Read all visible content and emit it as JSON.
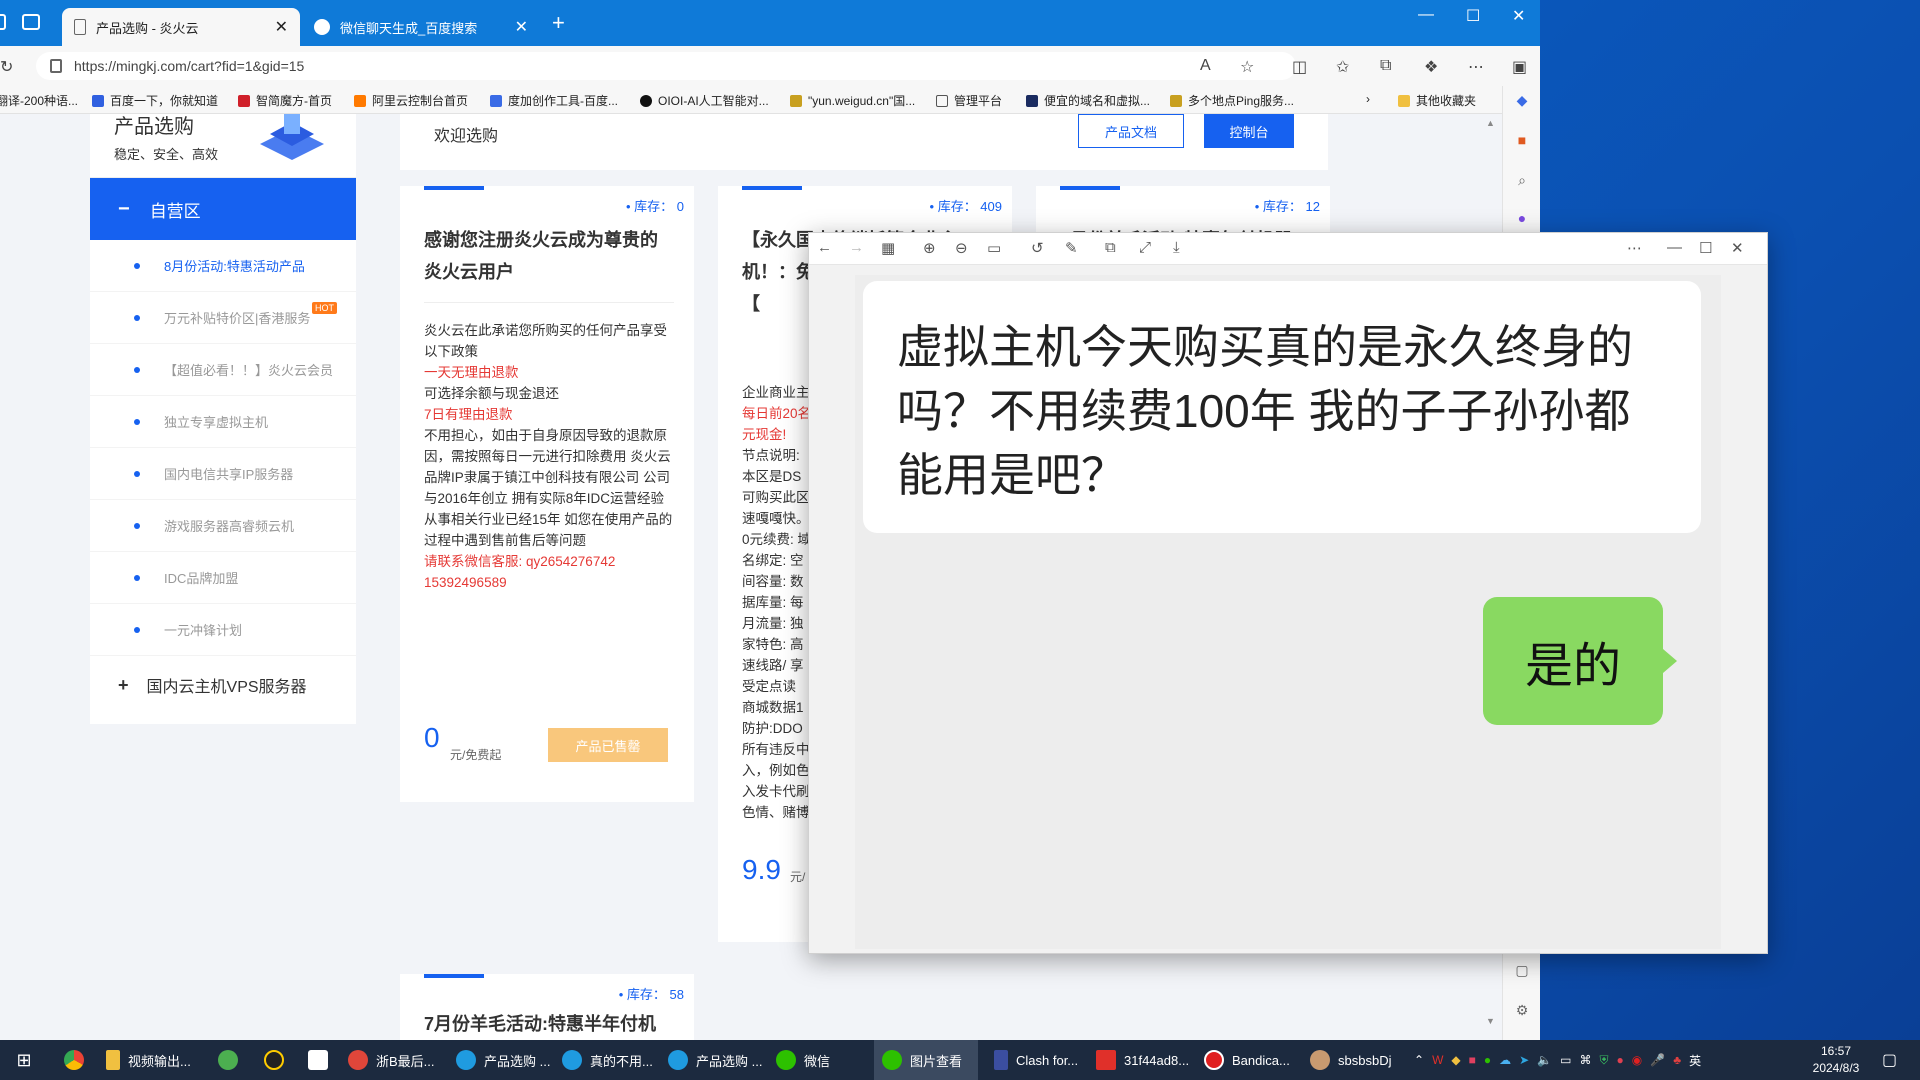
{
  "browser": {
    "tabs": [
      {
        "title": "产品选购 - 炎火云",
        "active": true
      },
      {
        "title": "微信聊天生成_百度搜索",
        "active": false
      }
    ],
    "url": "https://mingkj.com/cart?fid=1&gid=15",
    "bookmarks": [
      "翻译-200种语...",
      "百度一下，你就知道",
      "智简魔方-首页",
      "阿里云控制台首页",
      "度加创作工具-百度...",
      "OIOI-AI人工智能对...",
      "\"yun.weigud.cn\"国...",
      "管理平台",
      "便宜的域名和虚拟...",
      "多个地点Ping服务..."
    ],
    "bookmarks_more": "其他收藏夹"
  },
  "sidebar": {
    "title": "产品选购",
    "subtitle": "稳定、安全、高效",
    "group_expanded": "自营区",
    "items": [
      {
        "label": "8月份活动:特惠活动产品",
        "current": true
      },
      {
        "label": "万元补贴特价区|香港服务",
        "hot": "HOT"
      },
      {
        "label": "【超值必看！！】炎火云会员"
      },
      {
        "label": "独立专享虚拟主机"
      },
      {
        "label": "国内电信共享IP服务器"
      },
      {
        "label": "游戏服务器高睿频云机"
      },
      {
        "label": "IDC品牌加盟"
      },
      {
        "label": "一元冲锋计划"
      }
    ],
    "group_collapsed": "国内云主机VPS服务器"
  },
  "topbar": {
    "welcome": "欢迎选购",
    "doc_button": "产品文档",
    "console_button": "控制台"
  },
  "cards": [
    {
      "stock": "• 库存： 0",
      "title": "感谢您注册炎火云成为尊贵的炎火云用户",
      "desc": [
        {
          "text": "炎火云在此承诺您所购买的任何产品享受以下政策",
          "red": false
        },
        {
          "text": "一天无理由退款",
          "red": true
        },
        {
          "text": "可选择余额与现金退还",
          "red": false
        },
        {
          "text": "7日有理由退款",
          "red": true
        },
        {
          "text": "不用担心，如由于自身原因导致的退款原因，需按照每日一元进行扣除费用 炎火云品牌IP隶属于镇江中创科技有限公司 公司与2016年创立 拥有实际8年IDC运营经验 从事相关行业已经15年 如您在使用产品的过程中遇到售前售后等问题",
          "red": false
        },
        {
          "text": "请联系微信客服: qy2654276742 15392496589",
          "red": true
        }
      ],
      "price": "0",
      "price_unit": "元/免费起",
      "button": "产品已售罄"
    },
    {
      "stock": "• 库存： 409",
      "title": "【永久国内终端托管企业主机！：免费名】1H1G 拟主机【",
      "desc": [
        {
          "text": "企业商业主",
          "red": false
        },
        {
          "text": "每日前20名 元现金!",
          "red": true
        },
        {
          "text": "节点说明: 本区是DS 可购买此区 速嘎嘎快。 0元续费: 域名绑定: 空间容量: 数据库量: 每月流量: 独家特色: 高速线路/ 享受定点读 商城数据1 防护:DDO 所有违反中 入，例如色 入发卡代刷 色情、赌博",
          "red": false
        }
      ],
      "price": "9.9",
      "price_unit": "元/",
      "button": ""
    },
    {
      "stock": "• 库存： 12",
      "title": "8月份羊毛活动:特惠年付机器",
      "desc": [],
      "price": "",
      "price_unit": "",
      "button": ""
    },
    {
      "stock": "• 库存： 58",
      "title": "7月份羊毛活动:特惠半年付机",
      "desc": [],
      "price": "",
      "price_unit": "",
      "button": ""
    }
  ],
  "viewer": {
    "message_left": "虚拟主机今天购买真的是永久终身的吗？不用续费100年 我的子子孙孙都能用是吧？",
    "message_right": "是的",
    "colors": {
      "bubble_right": "#89d961",
      "bubble_left": "#ffffff"
    }
  },
  "taskbar": {
    "items": [
      {
        "label": "视频输出..."
      },
      {
        "label": "浙B最后..."
      },
      {
        "label": "产品选购 ..."
      },
      {
        "label": "真的不用..."
      },
      {
        "label": "产品选购 ..."
      },
      {
        "label": "微信"
      },
      {
        "label": "图片查看",
        "active": true
      },
      {
        "label": "Clash for..."
      },
      {
        "label": "31f44ad8..."
      },
      {
        "label": "Bandica..."
      },
      {
        "label": "sbsbsbDj"
      }
    ],
    "ime": "英",
    "time": "16:57",
    "date": "2024/8/3"
  }
}
